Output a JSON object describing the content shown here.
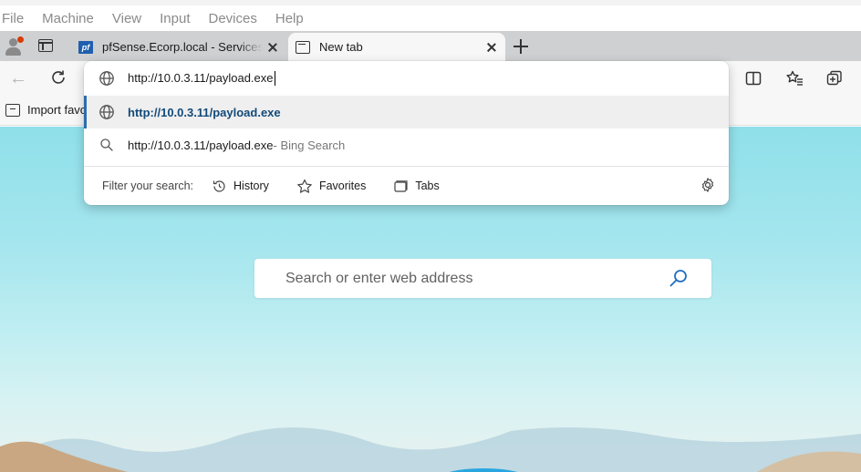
{
  "vm_menu": [
    "File",
    "Machine",
    "View",
    "Input",
    "Devices",
    "Help"
  ],
  "tabs": [
    {
      "title": "pfSense.Ecorp.local - Services: Snort",
      "favicon": "pfsense-favicon"
    },
    {
      "title": "New tab",
      "favicon": "new-tab-icon"
    }
  ],
  "favorites_bar": {
    "import_label": "Import favo"
  },
  "address_bar": {
    "value": "http://10.0.3.11/payload.exe"
  },
  "suggestions": {
    "url": "http://10.0.3.11/payload.exe",
    "search_query": "http://10.0.3.11/payload.exe",
    "search_suffix": " - Bing Search"
  },
  "filter": {
    "label": "Filter your search:",
    "chips": [
      "History",
      "Favorites",
      "Tabs"
    ]
  },
  "new_tab_page": {
    "search_placeholder": "Search or enter web address"
  },
  "colors": {
    "accent": "#2b6cb0",
    "selected_row": "#efefef",
    "tabstrip": "#cfd0d1"
  }
}
